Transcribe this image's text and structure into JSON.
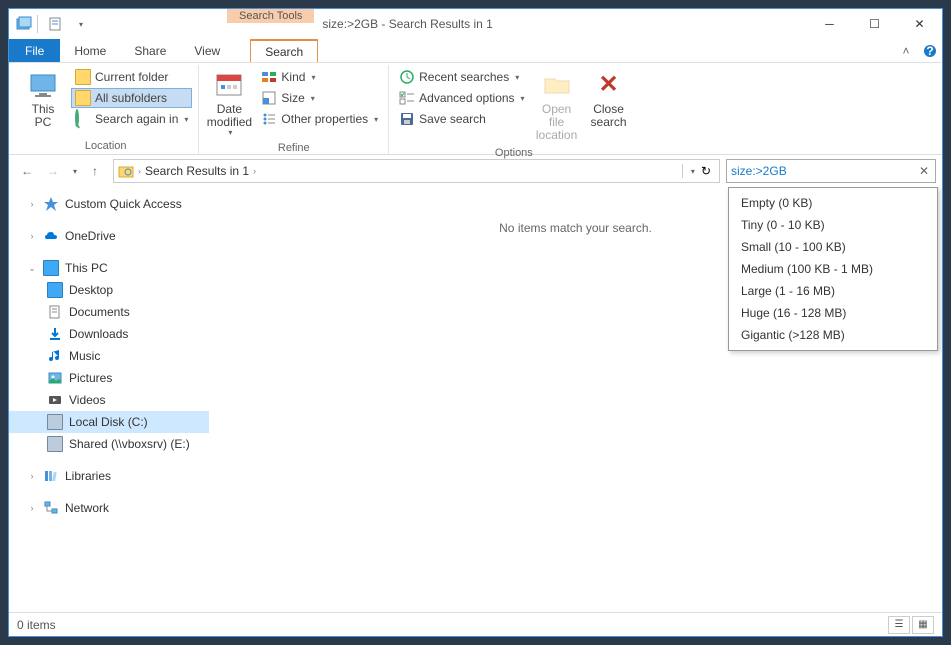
{
  "titlebar": {
    "context_label": "Search Tools",
    "title": "size:>2GB - Search Results in 1"
  },
  "tabs": {
    "file": "File",
    "home": "Home",
    "share": "Share",
    "view": "View",
    "search": "Search"
  },
  "ribbon": {
    "location": {
      "this_pc": "This\nPC",
      "current_folder": "Current folder",
      "all_subfolders": "All subfolders",
      "search_again": "Search again in",
      "group": "Location"
    },
    "refine": {
      "date_modified": "Date\nmodified",
      "kind": "Kind",
      "size": "Size",
      "other_props": "Other properties",
      "group": "Refine"
    },
    "options": {
      "recent": "Recent searches",
      "advanced": "Advanced options",
      "save": "Save search",
      "open_loc": "Open file\nlocation",
      "close": "Close\nsearch",
      "group": "Options"
    }
  },
  "breadcrumb": {
    "text": "Search Results in 1"
  },
  "search": {
    "value": "size:>2GB"
  },
  "tree": {
    "quick_access": "Custom Quick Access",
    "onedrive": "OneDrive",
    "this_pc": "This PC",
    "desktop": "Desktop",
    "documents": "Documents",
    "downloads": "Downloads",
    "music": "Music",
    "pictures": "Pictures",
    "videos": "Videos",
    "local_disk": "Local Disk (C:)",
    "shared": "Shared (\\\\vboxsrv) (E:)",
    "libraries": "Libraries",
    "network": "Network"
  },
  "main": {
    "no_items": "No items match your search."
  },
  "size_filter": {
    "empty": "Empty (0 KB)",
    "tiny": "Tiny (0 - 10 KB)",
    "small": "Small (10 - 100 KB)",
    "medium": "Medium (100 KB - 1 MB)",
    "large": "Large (1 - 16 MB)",
    "huge": "Huge (16 - 128 MB)",
    "gigantic": "Gigantic (>128 MB)"
  },
  "status": {
    "items": "0 items"
  }
}
